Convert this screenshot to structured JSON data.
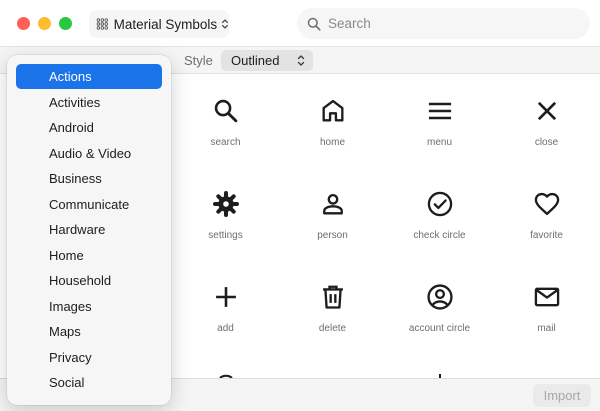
{
  "window": {
    "collection_label": "Material Symbols",
    "search_placeholder": "Search"
  },
  "stylebar": {
    "label": "Style",
    "selected": "Outlined"
  },
  "icons": [
    {
      "name": "search",
      "label": "search"
    },
    {
      "name": "home",
      "label": "home"
    },
    {
      "name": "menu",
      "label": "menu"
    },
    {
      "name": "close",
      "label": "close"
    },
    {
      "name": "settings",
      "label": "settings"
    },
    {
      "name": "person",
      "label": "person"
    },
    {
      "name": "check-circle",
      "label": "check circle"
    },
    {
      "name": "favorite",
      "label": "favorite"
    },
    {
      "name": "add",
      "label": "add"
    },
    {
      "name": "delete",
      "label": "delete"
    },
    {
      "name": "account-circle",
      "label": "account circle"
    },
    {
      "name": "mail",
      "label": "mail"
    }
  ],
  "categories": {
    "selected": "Actions",
    "items": [
      "Actions",
      "Activities",
      "Android",
      "Audio & Video",
      "Business",
      "Communicate",
      "Hardware",
      "Home",
      "Household",
      "Images",
      "Maps",
      "Privacy",
      "Social"
    ]
  },
  "footer": {
    "import_label": "Import"
  },
  "colors": {
    "accent": "#1a73e8",
    "close": "#fe5f57",
    "minimize": "#febc2e",
    "maximize": "#28c840"
  }
}
